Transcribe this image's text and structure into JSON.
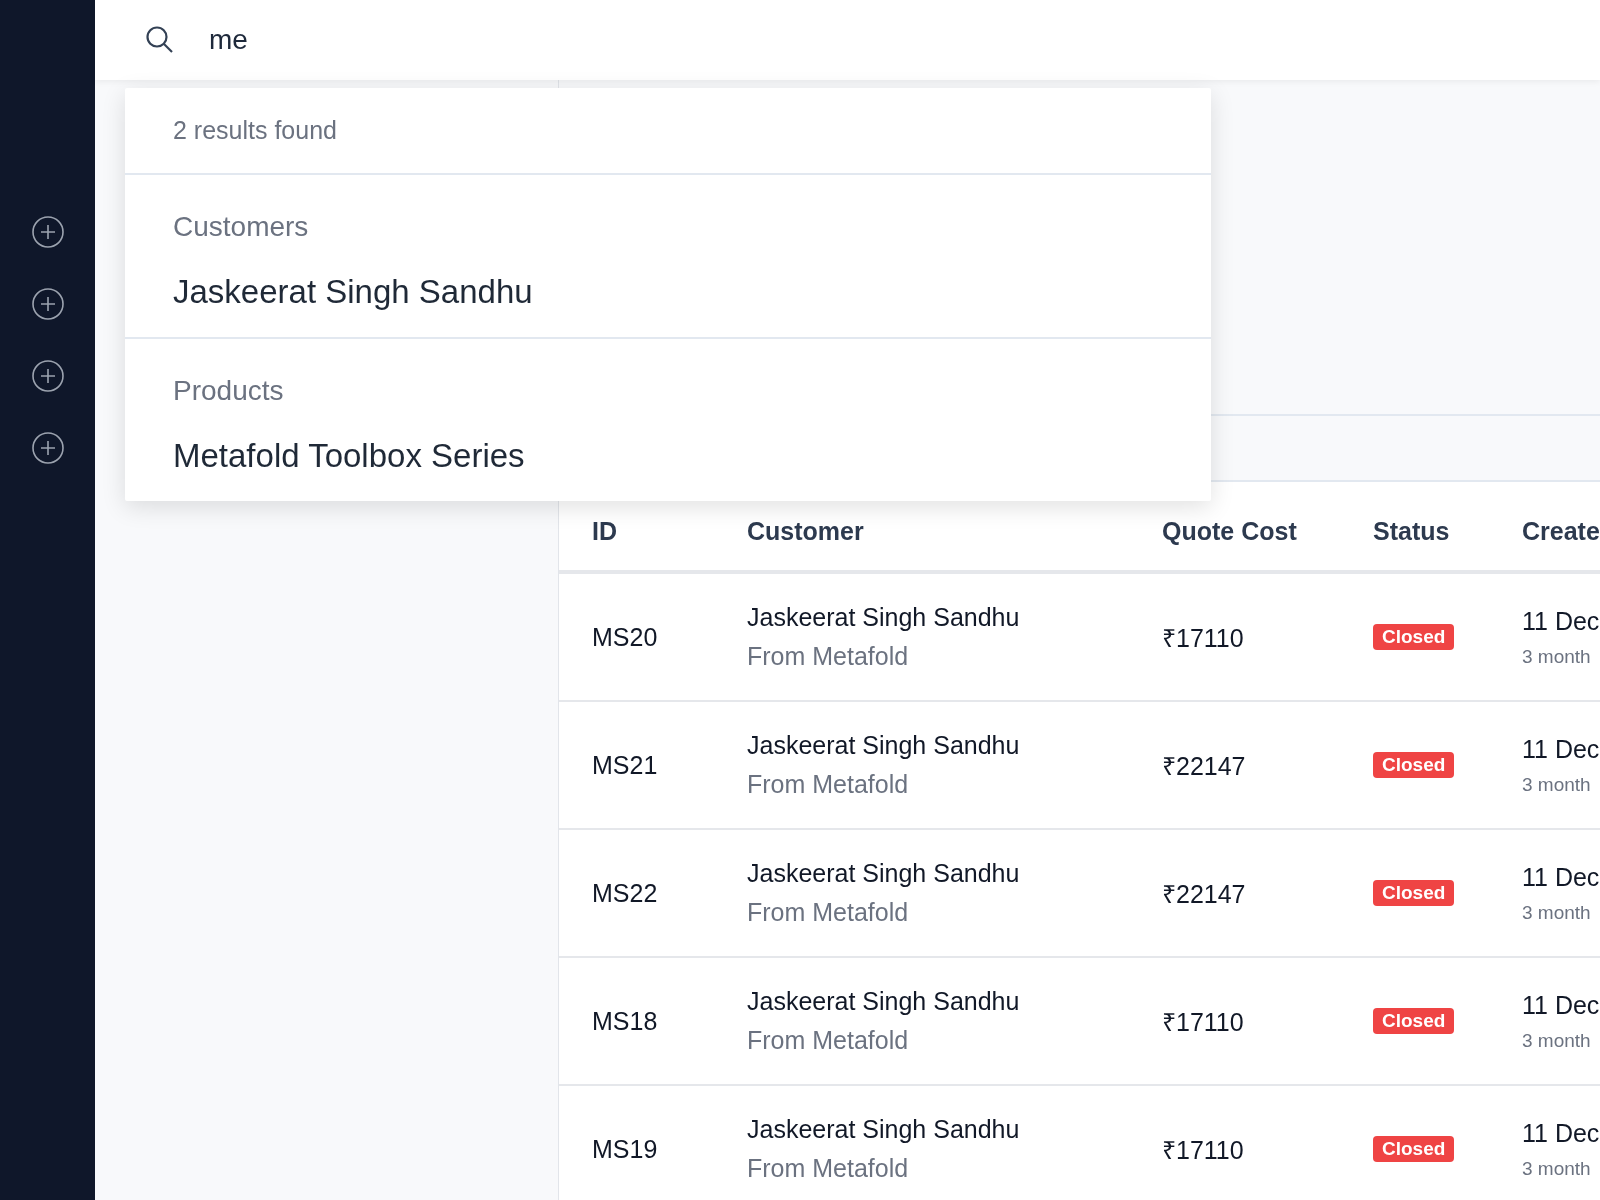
{
  "search": {
    "value": "me"
  },
  "results": {
    "summary": "2 results found",
    "groups": [
      {
        "heading": "Customers",
        "items": [
          "Jaskeerat Singh Sandhu"
        ]
      },
      {
        "heading": "Products",
        "items": [
          "Metafold Toolbox Series"
        ]
      }
    ]
  },
  "table": {
    "columns": [
      "ID",
      "Customer",
      "Quote Cost",
      "Status",
      "Create"
    ],
    "rows": [
      {
        "id": "MS20",
        "customer": "Jaskeerat Singh Sandhu",
        "company": "From Metafold",
        "cost": "₹17110",
        "status": "Closed",
        "date": "11 Dec",
        "age": "3 month"
      },
      {
        "id": "MS21",
        "customer": "Jaskeerat Singh Sandhu",
        "company": "From Metafold",
        "cost": "₹22147",
        "status": "Closed",
        "date": "11 Dec",
        "age": "3 month"
      },
      {
        "id": "MS22",
        "customer": "Jaskeerat Singh Sandhu",
        "company": "From Metafold",
        "cost": "₹22147",
        "status": "Closed",
        "date": "11 Dec",
        "age": "3 month"
      },
      {
        "id": "MS18",
        "customer": "Jaskeerat Singh Sandhu",
        "company": "From Metafold",
        "cost": "₹17110",
        "status": "Closed",
        "date": "11 Dec",
        "age": "3 month"
      },
      {
        "id": "MS19",
        "customer": "Jaskeerat Singh Sandhu",
        "company": "From Metafold",
        "cost": "₹17110",
        "status": "Closed",
        "date": "11 Dec",
        "age": "3 month"
      }
    ]
  }
}
